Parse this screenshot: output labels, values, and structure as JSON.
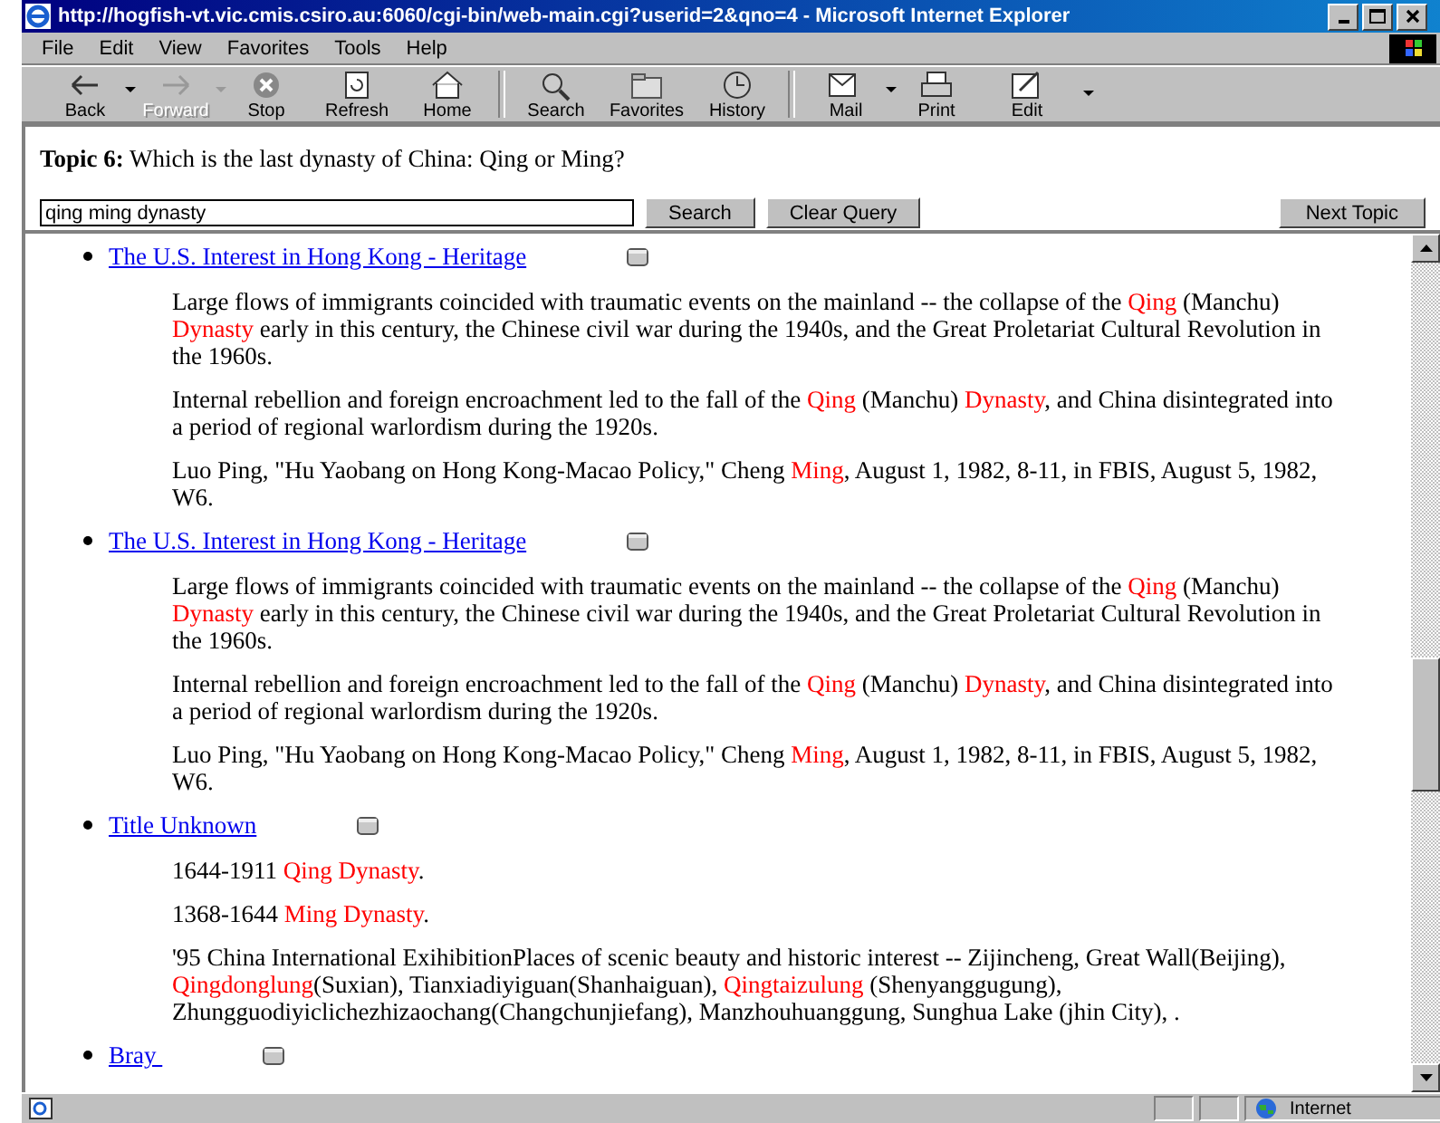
{
  "window": {
    "title": "http://hogfish-vt.vic.cmis.csiro.au:6060/cgi-bin/web-main.cgi?userid=2&qno=4 - Microsoft Internet Explorer"
  },
  "menu": [
    "File",
    "Edit",
    "View",
    "Favorites",
    "Tools",
    "Help"
  ],
  "toolbar": [
    {
      "label": "Back",
      "kind": "back",
      "disabled": false,
      "dropdown": true
    },
    {
      "label": "Forward",
      "kind": "forward",
      "disabled": true,
      "dropdown": true
    },
    {
      "label": "Stop",
      "kind": "stop",
      "disabled": false,
      "dropdown": false
    },
    {
      "label": "Refresh",
      "kind": "refresh",
      "disabled": false,
      "dropdown": false
    },
    {
      "label": "Home",
      "kind": "home",
      "disabled": false,
      "dropdown": false
    },
    {
      "label": "Search",
      "kind": "search",
      "disabled": false,
      "dropdown": false
    },
    {
      "label": "Favorites",
      "kind": "favorites",
      "disabled": false,
      "dropdown": false
    },
    {
      "label": "History",
      "kind": "history",
      "disabled": false,
      "dropdown": false
    },
    {
      "label": "Mail",
      "kind": "mail",
      "disabled": false,
      "dropdown": true
    },
    {
      "label": "Print",
      "kind": "print",
      "disabled": false,
      "dropdown": false
    },
    {
      "label": "Edit",
      "kind": "edit",
      "disabled": false,
      "dropdown": false
    }
  ],
  "topic": {
    "label": "Topic 6:",
    "question": "Which is the last dynasty of China: Qing or Ming?"
  },
  "query": {
    "value": "qing ming dynasty",
    "buttons": [
      "Search",
      "Clear Query"
    ],
    "next": "Next Topic"
  },
  "results": [
    {
      "title": "The U.S. Interest in Hong Kong - Heritage",
      "paragraphs": [
        [
          {
            "text": "Large flows of immigrants coincided with traumatic events on the mainland -- the collapse of the "
          },
          {
            "text": "Qing",
            "highlight": true
          },
          {
            "text": " (Manchu) "
          },
          {
            "text": "Dynasty",
            "highlight": true
          },
          {
            "text": " early in this century, the Chinese civil war during the 1940s, and the Great Proletariat Cultural Revolution in the 1960s."
          }
        ],
        [
          {
            "text": "Internal rebellion and foreign encroachment led to the fall of the "
          },
          {
            "text": "Qing",
            "highlight": true
          },
          {
            "text": " (Manchu) "
          },
          {
            "text": "Dynasty",
            "highlight": true
          },
          {
            "text": ", and China disintegrated into a period of regional warlordism during the 1920s."
          }
        ],
        [
          {
            "text": "Luo Ping, \"Hu Yaobang on Hong Kong-Macao Policy,\" Cheng "
          },
          {
            "text": "Ming",
            "highlight": true
          },
          {
            "text": ", August 1, 1982, 8-11, in FBIS, August 5, 1982, W6."
          }
        ]
      ]
    },
    {
      "title": "The U.S. Interest in Hong Kong - Heritage",
      "paragraphs": [
        [
          {
            "text": "Large flows of immigrants coincided with traumatic events on the mainland -- the collapse of the "
          },
          {
            "text": "Qing",
            "highlight": true
          },
          {
            "text": " (Manchu) "
          },
          {
            "text": "Dynasty",
            "highlight": true
          },
          {
            "text": " early in this century, the Chinese civil war during the 1940s, and the Great Proletariat Cultural Revolution in the 1960s."
          }
        ],
        [
          {
            "text": "Internal rebellion and foreign encroachment led to the fall of the "
          },
          {
            "text": "Qing",
            "highlight": true
          },
          {
            "text": " (Manchu) "
          },
          {
            "text": "Dynasty",
            "highlight": true
          },
          {
            "text": ", and China disintegrated into a period of regional warlordism during the 1920s."
          }
        ],
        [
          {
            "text": "Luo Ping, \"Hu Yaobang on Hong Kong-Macao Policy,\" Cheng "
          },
          {
            "text": "Ming",
            "highlight": true
          },
          {
            "text": ", August 1, 1982, 8-11, in FBIS, August 5, 1982, W6."
          }
        ]
      ]
    },
    {
      "title": "Title Unknown",
      "paragraphs": [
        [
          {
            "text": "1644-1911 "
          },
          {
            "text": "Qing Dynasty",
            "highlight": true
          },
          {
            "text": "."
          }
        ],
        [
          {
            "text": "1368-1644 "
          },
          {
            "text": "Ming Dynasty",
            "highlight": true
          },
          {
            "text": "."
          }
        ],
        [
          {
            "text": "'95 China International ExihibitionPlaces of scenic beauty and historic interest -- Zijincheng, Great Wall(Beijing), "
          },
          {
            "text": "Qingdonglung",
            "highlight": true
          },
          {
            "text": "(Suxian), Tianxiadiyiguan(Shanhaiguan), "
          },
          {
            "text": "Qingtaizulung",
            "highlight": true
          },
          {
            "text": " (Shenyanggugung), Zhungguodiyiclichezhizaochang(Changchunjiefang), Manzhouhuanggung, Sunghua Lake (jhin City), ."
          }
        ]
      ]
    },
    {
      "title": "Bray "
    }
  ],
  "status_bar": {
    "zone": "Internet"
  }
}
